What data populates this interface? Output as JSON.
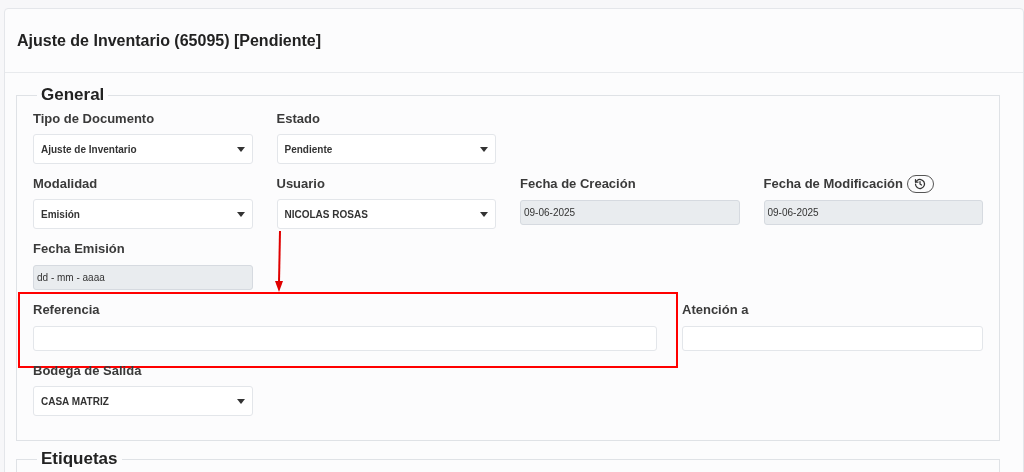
{
  "page": {
    "title": "Ajuste de Inventario (65095) [Pendiente]"
  },
  "sections": [
    {
      "legend": "General",
      "rows": [
        {
          "kind": "standard",
          "fields": [
            {
              "label": "Tipo de Documento",
              "kind": "select",
              "value": "Ajuste de Inventario",
              "disabled": false,
              "history_button": false,
              "highlighted": false
            },
            {
              "label": "Estado",
              "kind": "select",
              "value": "Pendiente",
              "disabled": false,
              "history_button": false,
              "highlighted": false
            }
          ]
        },
        {
          "kind": "standard",
          "fields": [
            {
              "label": "Modalidad",
              "kind": "select",
              "value": "Emisión",
              "disabled": false,
              "history_button": false,
              "highlighted": false
            },
            {
              "label": "Usuario",
              "kind": "select",
              "value": "NICOLAS ROSAS",
              "disabled": false,
              "history_button": false,
              "highlighted": false
            },
            {
              "label": "Fecha de Creación",
              "kind": "text",
              "value": "09-06-2025",
              "disabled": true,
              "history_button": false,
              "highlighted": false
            },
            {
              "label": "Fecha de Modificación",
              "kind": "text",
              "value": "09-06-2025",
              "disabled": true,
              "history_button": true,
              "highlighted": false
            }
          ]
        },
        {
          "kind": "standard",
          "fields": [
            {
              "label": "Fecha Emisión",
              "kind": "date",
              "placeholder": "dd - mm - aaaa",
              "disabled": true,
              "history_button": false,
              "highlighted": false
            }
          ]
        },
        {
          "kind": "wide",
          "fields": [
            {
              "label": "Referencia",
              "kind": "text",
              "disabled": false,
              "history_button": false,
              "highlighted": true
            },
            {
              "label": "Atención a",
              "kind": "text",
              "disabled": false,
              "history_button": false,
              "highlighted": false
            }
          ]
        },
        {
          "kind": "standard",
          "fields": [
            {
              "label": "Bodega de Salida",
              "kind": "select",
              "value": "CASA MATRIZ",
              "disabled": false,
              "history_button": false,
              "highlighted": false
            }
          ]
        }
      ]
    },
    {
      "legend": "Etiquetas"
    }
  ]
}
